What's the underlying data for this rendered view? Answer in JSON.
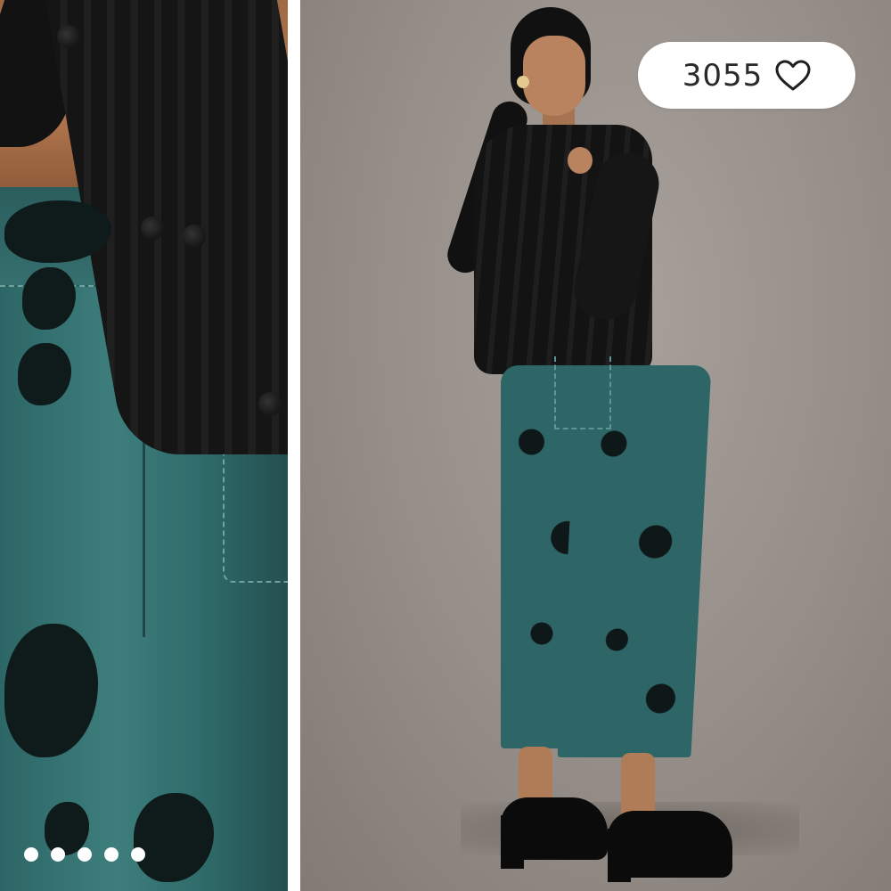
{
  "gallery": {
    "likes": {
      "count": "3055",
      "icon": "heart-icon"
    },
    "carousel": {
      "dot_count": 5,
      "active_index": 0
    },
    "images": [
      {
        "name": "closeup-pants-image"
      },
      {
        "name": "full-model-image"
      }
    ]
  },
  "colors": {
    "pill_background": "#ffffff",
    "text": "#2a2a2a",
    "pants_teal": "#2e6566",
    "studio_background": "#958d87"
  }
}
